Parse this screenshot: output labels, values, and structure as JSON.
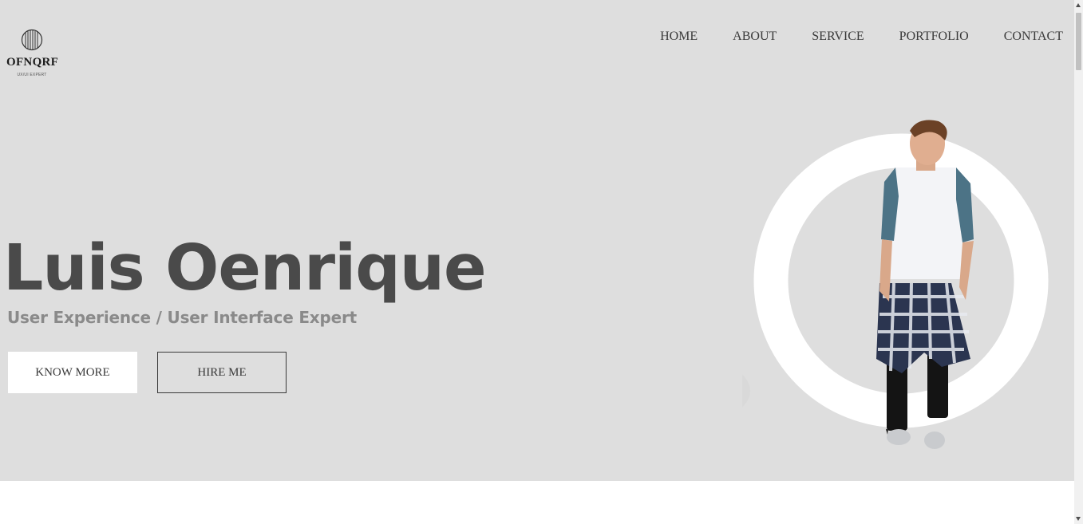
{
  "brand": {
    "name": "OFNQRF",
    "tagline": "UX/UI EXPERT",
    "logo_icon": "striped-globe-icon"
  },
  "nav": {
    "items": [
      {
        "label": "HOME"
      },
      {
        "label": "ABOUT"
      },
      {
        "label": "SERVICE"
      },
      {
        "label": "PORTFOLIO"
      },
      {
        "label": "CONTACT"
      }
    ]
  },
  "hero": {
    "name": "Luis Oenrique",
    "subtitle": "User Experience / User Interface Expert",
    "primary_button": "KNOW MORE",
    "secondary_button": "HIRE ME",
    "image": "man-in-raglan-tee-portrait"
  },
  "colors": {
    "hero_background": "#dedede",
    "headline": "#4a4a4a",
    "subtitle": "#8a8a8a",
    "ring": "#ffffff"
  }
}
